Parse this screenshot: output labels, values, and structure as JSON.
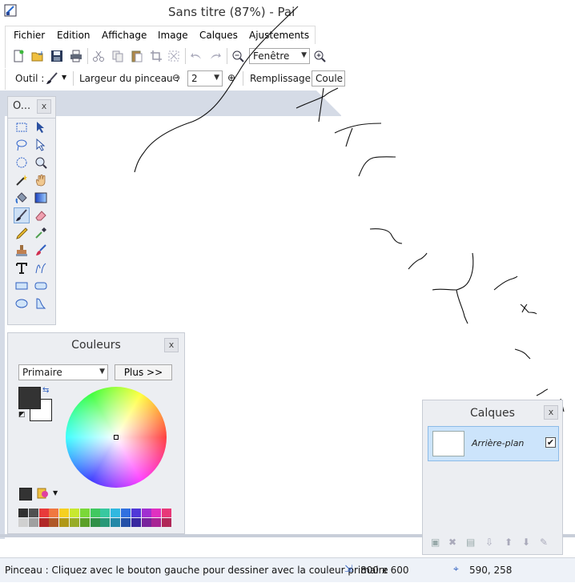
{
  "window": {
    "title": "Sans titre (87%) - Pai"
  },
  "menu": {
    "items": [
      "Fichier",
      "Edition",
      "Affichage",
      "Image",
      "Calques",
      "Ajustements"
    ]
  },
  "toolbar": {
    "zoom_value": "Fenêtre",
    "tool_label": "Outil :",
    "brush_width_label": "Largeur du pinceau :",
    "brush_width_value": "2",
    "fill_label": "Remplissage :",
    "fill_value": "Coule"
  },
  "tools_panel": {
    "title": "O...",
    "close": "x"
  },
  "colors_panel": {
    "title": "Couleurs",
    "close": "x",
    "mode_value": "Primaire",
    "more_button": "Plus >>",
    "primary_color": "#333333",
    "secondary_color": "#ffffff",
    "palette": [
      "#303030",
      "#505050",
      "#e83a3a",
      "#f07840",
      "#f5d020",
      "#c8e830",
      "#7ad838",
      "#40c860",
      "#38c8a0",
      "#30b8e0",
      "#3070e0",
      "#5038d8",
      "#a030d0",
      "#e030c0",
      "#e83878",
      "#d0d0d0",
      "#a0a0a0",
      "#b02828",
      "#b05828",
      "#b09818",
      "#98ac28",
      "#5aa028",
      "#309048",
      "#289878",
      "#2488a8",
      "#2450a8",
      "#3828a0",
      "#78249c",
      "#a82494",
      "#b02858"
    ]
  },
  "layers_panel": {
    "title": "Calques",
    "close": "x",
    "layer_name": "Arrière-plan",
    "layer_visible": "✔"
  },
  "status": {
    "message": "Pinceau : Cliquez avec le bouton gauche pour dessiner avec la couleur primaire",
    "image_size": "800 x 600",
    "cursor_position": "590, 258"
  }
}
